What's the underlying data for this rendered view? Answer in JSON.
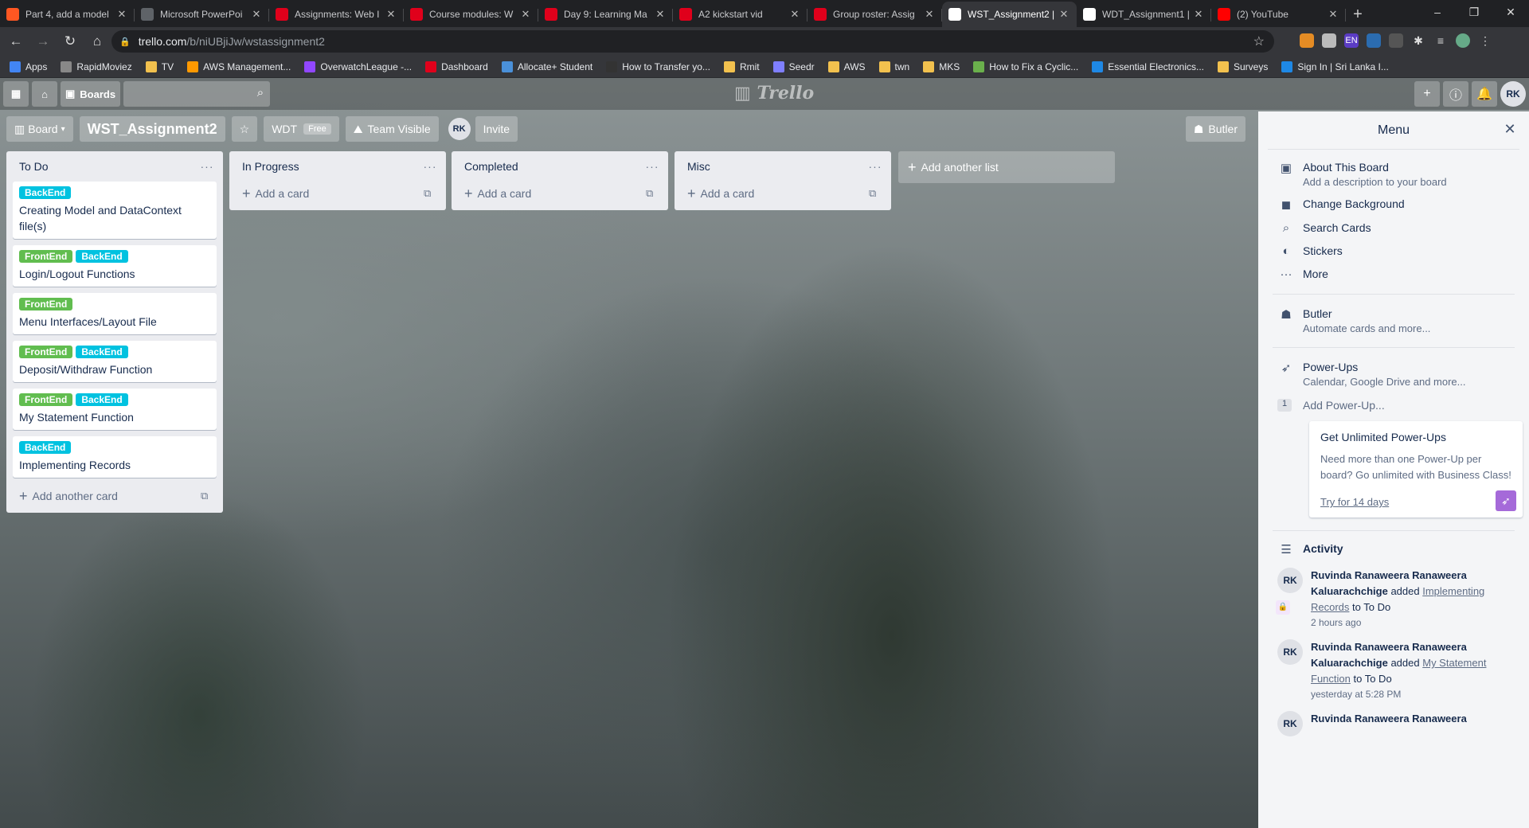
{
  "browser": {
    "tabs": [
      {
        "title": "Part 4, add a model",
        "fav": "#ff5722",
        "active": false
      },
      {
        "title": "Microsoft PowerPoi",
        "fav": "#5f6368",
        "active": false
      },
      {
        "title": "Assignments: Web I",
        "fav": "#e0001b",
        "active": false
      },
      {
        "title": "Course modules: W",
        "fav": "#e0001b",
        "active": false
      },
      {
        "title": "Day 9: Learning Ma",
        "fav": "#e0001b",
        "active": false
      },
      {
        "title": "A2 kickstart vid",
        "fav": "#e0001b",
        "active": false
      },
      {
        "title": "Group roster: Assig",
        "fav": "#e0001b",
        "active": false
      },
      {
        "title": "WST_Assignment2 |",
        "fav": "#ffffff",
        "active": true
      },
      {
        "title": "WDT_Assignment1 |",
        "fav": "#ffffff",
        "active": false
      },
      {
        "title": "(2) YouTube",
        "fav": "#ff0000",
        "active": false
      }
    ],
    "url_host": "trello.com",
    "url_path": "/b/niUBjiJw/wstassignment2",
    "bookmarks": [
      {
        "label": "Apps",
        "color": "#4285f4"
      },
      {
        "label": "RapidMoviez",
        "color": "#888888"
      },
      {
        "label": "TV",
        "color": "#f2c14e"
      },
      {
        "label": "AWS Management...",
        "color": "#ff9900"
      },
      {
        "label": "OverwatchLeague -...",
        "color": "#9147ff"
      },
      {
        "label": "Dashboard",
        "color": "#e0001b"
      },
      {
        "label": "Allocate+ Student",
        "color": "#4a90d9"
      },
      {
        "label": "How to Transfer yo...",
        "color": "#333333"
      },
      {
        "label": "Rmit",
        "color": "#f2c14e"
      },
      {
        "label": "Seedr",
        "color": "#7f7fff"
      },
      {
        "label": "AWS",
        "color": "#f2c14e"
      },
      {
        "label": "twn",
        "color": "#f2c14e"
      },
      {
        "label": "MKS",
        "color": "#f2c14e"
      },
      {
        "label": "How to Fix a Cyclic...",
        "color": "#6ab04c"
      },
      {
        "label": "Essential Electronics...",
        "color": "#1e88e5"
      },
      {
        "label": "Surveys",
        "color": "#f2c14e"
      },
      {
        "label": "Sign In | Sri Lanka I...",
        "color": "#1e88e5"
      }
    ]
  },
  "trello": {
    "header": {
      "boards_label": "Boards",
      "logo": "Trello",
      "avatar": "RK"
    },
    "board": {
      "view_label": "Board",
      "title": "WST_Assignment2",
      "team": "WDT",
      "team_badge": "Free",
      "visibility": "Team Visible",
      "member": "RK",
      "invite": "Invite",
      "butler": "Butler"
    },
    "lists": [
      {
        "title": "To Do",
        "cards": [
          {
            "labels": [
              "BackEnd"
            ],
            "text": "Creating Model and DataContext file(s)"
          },
          {
            "labels": [
              "FrontEnd",
              "BackEnd"
            ],
            "text": "Login/Logout Functions"
          },
          {
            "labels": [
              "FrontEnd"
            ],
            "text": "Menu Interfaces/Layout File"
          },
          {
            "labels": [
              "FrontEnd",
              "BackEnd"
            ],
            "text": "Deposit/Withdraw Function"
          },
          {
            "labels": [
              "FrontEnd",
              "BackEnd"
            ],
            "text": "My Statement Function"
          },
          {
            "labels": [
              "BackEnd"
            ],
            "text": "Implementing Records"
          }
        ],
        "add_label": "Add another card"
      },
      {
        "title": "In Progress",
        "cards": [],
        "add_label": "Add a card"
      },
      {
        "title": "Completed",
        "cards": [],
        "add_label": "Add a card"
      },
      {
        "title": "Misc",
        "cards": [],
        "add_label": "Add a card"
      }
    ],
    "add_list_label": "Add another list",
    "menu": {
      "title": "Menu",
      "items": [
        {
          "icon": "board-icon",
          "title": "About This Board",
          "sub": "Add a description to your board"
        },
        {
          "icon": "background-icon",
          "title": "Change Background",
          "sub": ""
        },
        {
          "icon": "search-icon",
          "title": "Search Cards",
          "sub": ""
        },
        {
          "icon": "sticker-icon",
          "title": "Stickers",
          "sub": ""
        },
        {
          "icon": "more-icon",
          "title": "More",
          "sub": ""
        }
      ],
      "butler": {
        "title": "Butler",
        "sub": "Automate cards and more..."
      },
      "powerups": {
        "title": "Power-Ups",
        "sub": "Calendar, Google Drive and more...",
        "count": "1",
        "add_label": "Add Power-Up..."
      },
      "promo": {
        "title": "Get Unlimited Power-Ups",
        "desc": "Need more than one Power-Up per board? Go unlimited with Business Class!",
        "link": "Try for 14 days"
      },
      "activity_title": "Activity",
      "activity": [
        {
          "avatar": "RK",
          "user": "Ruvinda Ranaweera Ranaweera Kaluarachchige",
          "verb": "added",
          "card": "Implementing Records",
          "list": "to To Do",
          "time": "2 hours ago"
        },
        {
          "avatar": "RK",
          "user": "Ruvinda Ranaweera Ranaweera Kaluarachchige",
          "verb": "added",
          "card": "My Statement Function",
          "list": "to To Do",
          "time": "yesterday at 5:28 PM"
        },
        {
          "avatar": "RK",
          "user": "Ruvinda Ranaweera Ranaweera",
          "verb": "",
          "card": "",
          "list": "",
          "time": ""
        }
      ]
    }
  }
}
